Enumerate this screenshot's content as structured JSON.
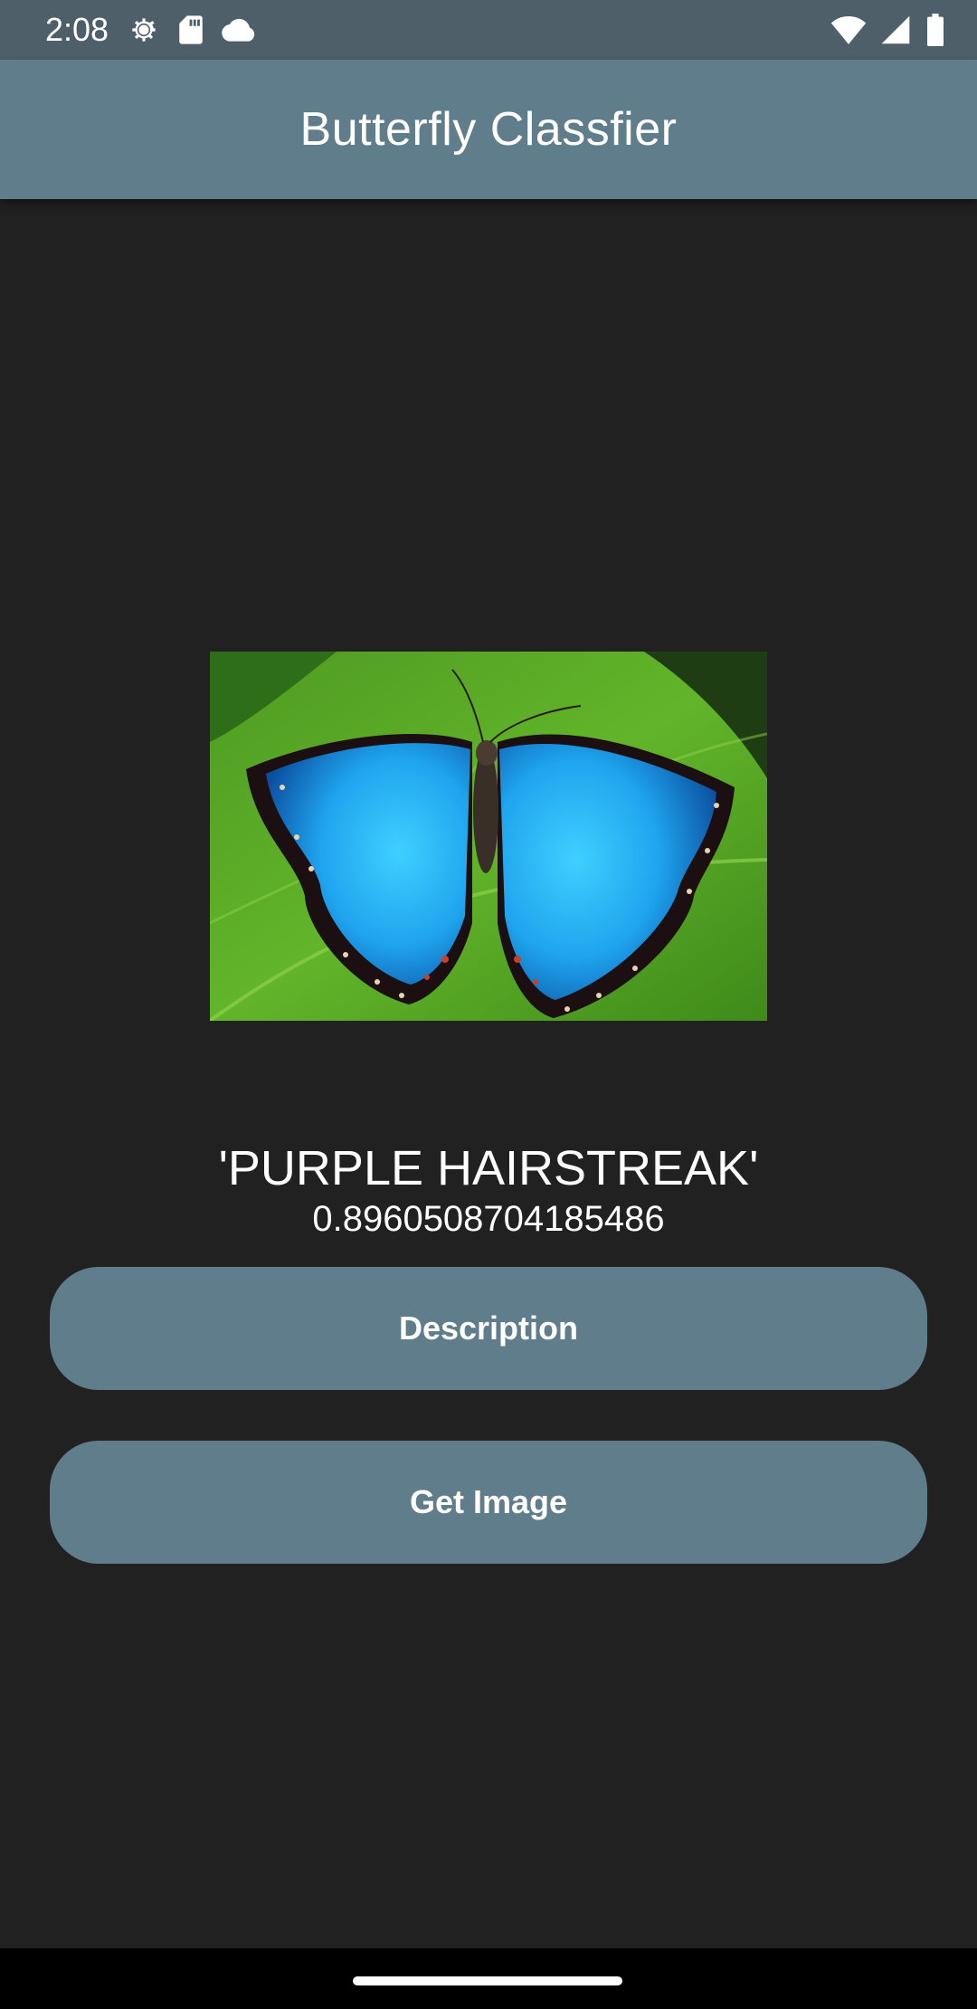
{
  "status_bar": {
    "time": "2:08",
    "left_icons": [
      "settings-gear-icon",
      "sd-card-icon",
      "cloud-icon"
    ],
    "right_icons": [
      "wifi-icon",
      "cellular-signal-icon",
      "battery-icon"
    ]
  },
  "app_bar": {
    "title": "Butterfly Classfier"
  },
  "result": {
    "label": "'PURPLE HAIRSTREAK'",
    "confidence": "0.8960508704185486"
  },
  "buttons": {
    "description": "Description",
    "get_image": "Get Image"
  },
  "colors": {
    "status_bar": "#4f5f6a",
    "app_bar": "#607d8b",
    "background": "#212121",
    "button": "#607d8b",
    "nav_bar": "#000000"
  }
}
